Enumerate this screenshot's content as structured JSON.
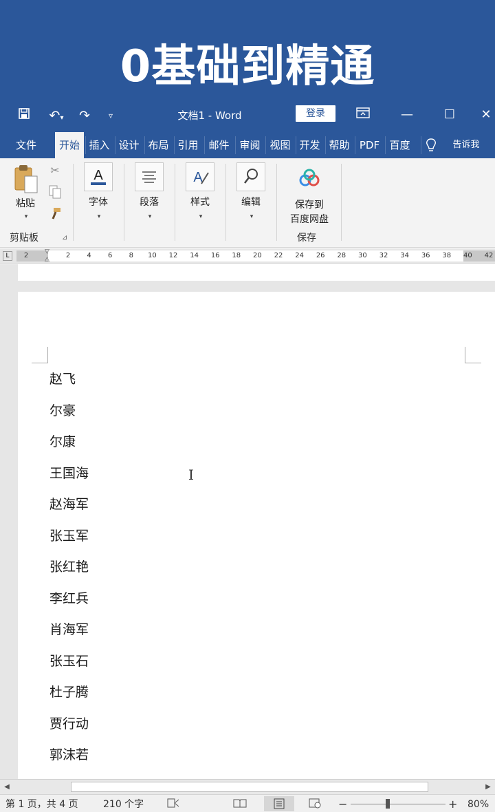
{
  "banner": {
    "title": "0基础到精通"
  },
  "titlebar": {
    "save_icon": "save-icon",
    "undo_icon": "undo-icon",
    "redo_icon": "redo-icon",
    "customize_icon": "customize-quick-access-icon",
    "doc_title": "文档1  -  Word",
    "login_label": "登录",
    "ribbon_display_icon": "ribbon-display-options-icon",
    "minimize_icon": "minimize-icon",
    "maximize_icon": "maximize-icon",
    "close_icon": "close-icon"
  },
  "tabs": [
    {
      "label": "文件"
    },
    {
      "label": "开始"
    },
    {
      "label": "插入"
    },
    {
      "label": "设计"
    },
    {
      "label": "布局"
    },
    {
      "label": "引用"
    },
    {
      "label": "邮件"
    },
    {
      "label": "审阅"
    },
    {
      "label": "视图"
    },
    {
      "label": "开发"
    },
    {
      "label": "帮助"
    },
    {
      "label": "PDF"
    },
    {
      "label": "百度"
    }
  ],
  "tell_me": {
    "label": "告诉我",
    "icon": "lightbulb-icon"
  },
  "ribbon": {
    "clipboard": {
      "paste_label": "粘贴",
      "group_label": "剪贴板"
    },
    "font": {
      "label": "字体"
    },
    "paragraph": {
      "label": "段落"
    },
    "styles": {
      "label": "样式"
    },
    "editing": {
      "label": "编辑"
    },
    "save": {
      "line1": "保存到",
      "line2": "百度网盘",
      "group_label": "保存"
    }
  },
  "ruler": {
    "ticks": [
      "2",
      "2",
      "4",
      "6",
      "8",
      "10",
      "12",
      "14",
      "16",
      "18",
      "20",
      "22",
      "24",
      "26",
      "28",
      "30",
      "32",
      "34",
      "36",
      "38",
      "40",
      "42"
    ]
  },
  "document": {
    "names": [
      "赵飞",
      "尔豪",
      "尔康",
      "王国海",
      "赵海军",
      "张玉军",
      "张红艳",
      "李红兵",
      "肖海军",
      "张玉石",
      "杜子腾",
      "贾行动",
      "郭沫若"
    ]
  },
  "statusbar": {
    "page_info": "第 1 页，共 4 页",
    "word_count": "210 个字",
    "zoom_level": "80%",
    "zoom_minus": "−",
    "zoom_plus": "+"
  },
  "colors": {
    "accent": "#2b579a",
    "ribbon_bg": "#f3f3f3"
  }
}
